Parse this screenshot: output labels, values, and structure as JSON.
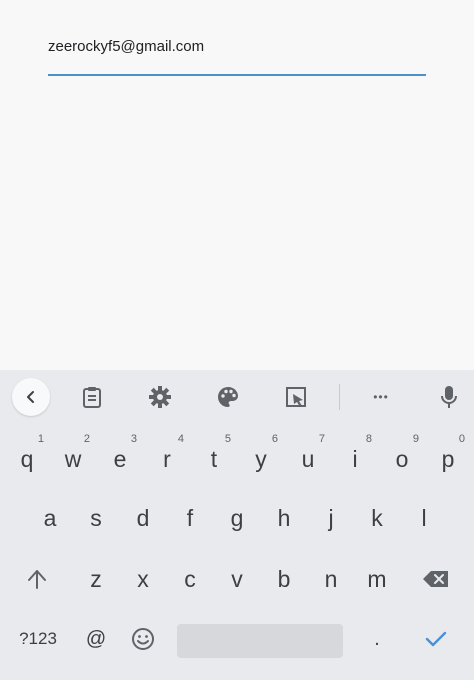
{
  "form": {
    "email_value": "zeerockyf5@gmail.com"
  },
  "toolbar": {
    "icons": [
      "back-chevron-icon",
      "clipboard-icon",
      "gear-icon",
      "palette-icon",
      "floating-keyboard-icon",
      "more-dots-icon",
      "mic-icon"
    ],
    "more_label": "•••"
  },
  "keyboard": {
    "row1": [
      {
        "key": "q",
        "hint": "1"
      },
      {
        "key": "w",
        "hint": "2"
      },
      {
        "key": "e",
        "hint": "3"
      },
      {
        "key": "r",
        "hint": "4"
      },
      {
        "key": "t",
        "hint": "5"
      },
      {
        "key": "y",
        "hint": "6"
      },
      {
        "key": "u",
        "hint": "7"
      },
      {
        "key": "i",
        "hint": "8"
      },
      {
        "key": "o",
        "hint": "9"
      },
      {
        "key": "p",
        "hint": "0"
      }
    ],
    "row2": [
      "a",
      "s",
      "d",
      "f",
      "g",
      "h",
      "j",
      "k",
      "l"
    ],
    "row3": [
      "z",
      "x",
      "c",
      "v",
      "b",
      "n",
      "m"
    ],
    "symbols_label": "?123",
    "at_label": "@",
    "period_label": "."
  },
  "colors": {
    "accent": "#4a90c9",
    "keyboard_bg": "#e8eaed",
    "content_bg": "#f8f8f8",
    "enter_check": "#4a90d9"
  }
}
